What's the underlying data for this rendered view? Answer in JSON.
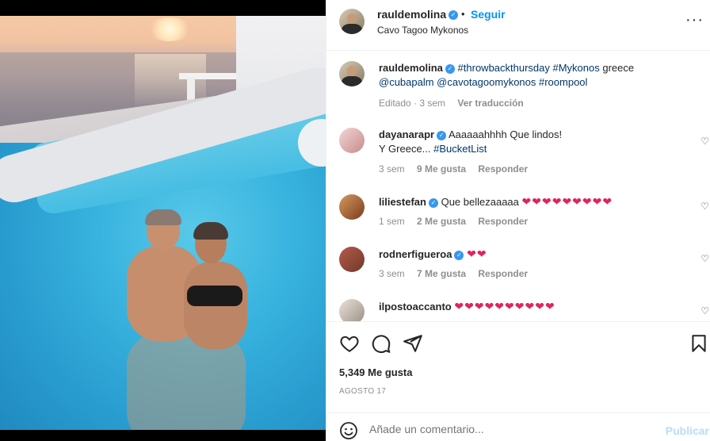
{
  "post": {
    "username": "rauldemolina",
    "follow_label": "Seguir",
    "separator": "•",
    "location": "Cavo Tagoo Mykonos",
    "more_label": "···"
  },
  "caption": {
    "username": "rauldemolina",
    "text_part1": "#throwbackthursday #Mykonos",
    "text_part2": " greece",
    "text_part3": "@cubapalm @cavotagoomykonos #roompool",
    "edited": "Editado · 3 sem",
    "translate": "Ver traducción"
  },
  "comments": [
    {
      "username": "dayanarapr",
      "text_line1": "Aaaaaahhhh Que lindos!",
      "text_line2": "Y Greece... ",
      "tag": "#BucketList",
      "time": "3 sem",
      "likes": "9 Me gusta",
      "reply": "Responder"
    },
    {
      "username": "liliestefan",
      "text": "Que bellezaaaaa",
      "hearts": "❤❤❤❤❤❤❤❤❤",
      "time": "1 sem",
      "likes": "2 Me gusta",
      "reply": "Responder"
    },
    {
      "username": "rodnerfigueroa",
      "hearts": "❤❤",
      "time": "3 sem",
      "likes": "7 Me gusta",
      "reply": "Responder"
    },
    {
      "username": "ilpostoaccanto",
      "hearts": "❤❤❤❤❤❤❤❤❤❤"
    }
  ],
  "stats": {
    "likes": "5,349 Me gusta",
    "date": "AGOSTO 17"
  },
  "composer": {
    "placeholder": "Añade un comentario...",
    "publish": "Publicar"
  },
  "icons": {
    "like": "heart-icon",
    "comment": "comment-icon",
    "share": "paper-plane-icon",
    "save": "bookmark-icon",
    "emoji": "smiley-icon",
    "verified": "verified-badge-icon"
  },
  "colors": {
    "link_blue": "#0095f6",
    "hashtag": "#00376b",
    "muted": "#8e8e8e",
    "heart_red": "#e0245e",
    "publish_disabled": "#b2dffc"
  }
}
